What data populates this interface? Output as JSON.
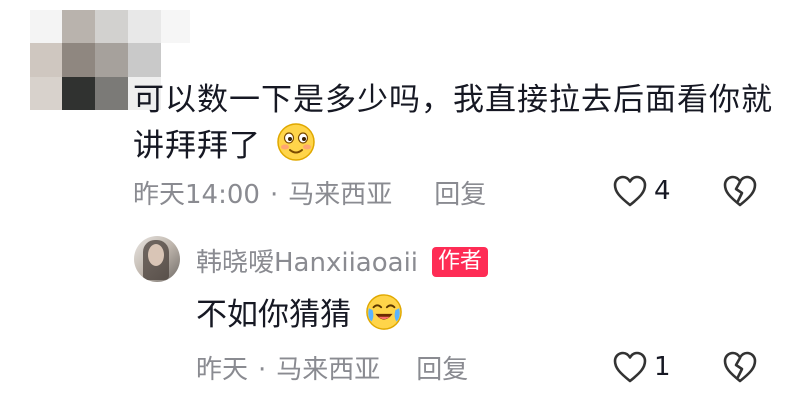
{
  "comment": {
    "text": "可以数一下是多少吗，我直接拉去后面看你就讲拜拜了",
    "emoji": "smiling-face-emoji",
    "time": "昨天14:00",
    "separator": "·",
    "location": "马来西亚",
    "reply_label": "回复",
    "like_count": "4"
  },
  "reply": {
    "username": "韩晓嗳Hanxiiaoaii",
    "badge": "作者",
    "text": "不如你猜猜",
    "emoji": "laugh-crying-emoji",
    "time": "昨天",
    "separator": "·",
    "location": "马来西亚",
    "reply_label": "回复",
    "like_count": "1"
  },
  "colors": {
    "text_primary": "#161823",
    "text_secondary": "#8a8b91",
    "badge_bg": "#fe2c55"
  }
}
